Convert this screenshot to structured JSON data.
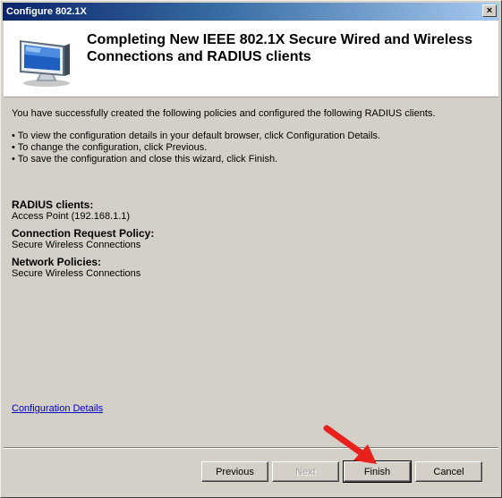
{
  "window": {
    "title": "Configure 802.1X",
    "close_label": "×"
  },
  "header": {
    "title": "Completing New IEEE 802.1X Secure Wired and Wireless Connections and RADIUS clients",
    "icon": "computer-monitor-icon"
  },
  "content": {
    "intro": "You have successfully created the following policies and configured the following RADIUS clients.",
    "bullets": [
      "• To view the configuration details in your default browser, click Configuration Details.",
      "• To change the configuration, click Previous.",
      "• To save the configuration and close this wizard, click Finish."
    ]
  },
  "summary": {
    "radius_label": "RADIUS clients:",
    "radius_value": "Access Point (192.168.1.1)",
    "crp_label": "Connection Request Policy:",
    "crp_value": "Secure Wireless Connections",
    "np_label": "Network Policies:",
    "np_value": "Secure Wireless Connections"
  },
  "config_details_link": "Configuration Details",
  "buttons": {
    "previous": "Previous",
    "next": "Next",
    "finish": "Finish",
    "cancel": "Cancel"
  },
  "colors": {
    "titlebar_start": "#0a246a",
    "titlebar_end": "#a6caf0",
    "dialog_bg": "#d4d0c8",
    "link": "#0000cc",
    "annotation_arrow": "#e8201c"
  }
}
